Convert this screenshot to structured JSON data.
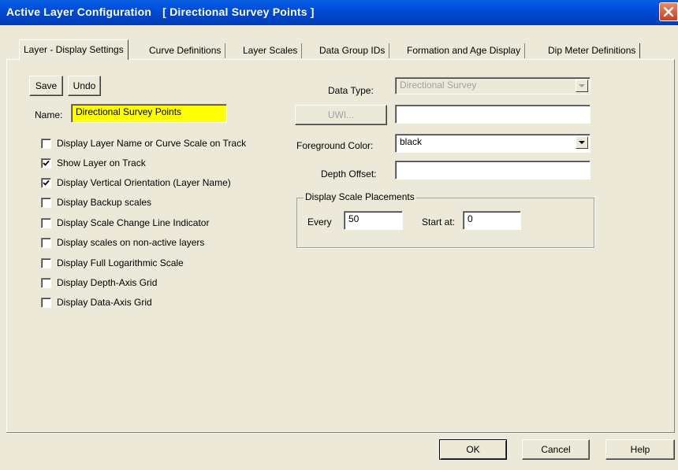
{
  "window": {
    "title_prefix": "Active Layer Configuration",
    "title_suffix": "[ Directional Survey Points ]"
  },
  "tabs": [
    {
      "label": "Layer - Display Settings",
      "active": true
    },
    {
      "label": "Curve Definitions",
      "active": false
    },
    {
      "label": "Layer Scales",
      "active": false
    },
    {
      "label": "Data Group IDs",
      "active": false
    },
    {
      "label": "Formation and Age Display",
      "active": false
    },
    {
      "label": "Dip Meter Definitions",
      "active": false
    }
  ],
  "left": {
    "save_label": "Save",
    "undo_label": "Undo",
    "name_label": "Name:",
    "name_value": "Directional Survey Points",
    "checkboxes": [
      {
        "label": "Display Layer Name or Curve Scale on Track",
        "checked": false
      },
      {
        "label": "Show Layer on Track",
        "checked": true
      },
      {
        "label": "Display Vertical Orientation (Layer Name)",
        "checked": true
      },
      {
        "label": "Display Backup scales",
        "checked": false
      },
      {
        "label": "Display Scale Change Line Indicator",
        "checked": false
      },
      {
        "label": "Display scales on non-active layers",
        "checked": false
      },
      {
        "label": "Display Full Logarithmic Scale",
        "checked": false
      },
      {
        "label": "Display Depth-Axis Grid",
        "checked": false
      },
      {
        "label": "Display Data-Axis Grid",
        "checked": false
      }
    ]
  },
  "right": {
    "data_type_label": "Data Type:",
    "data_type_value": "Directional Survey",
    "uwi_button": "UWI...",
    "uwi_value": "",
    "foreground_label": "Foreground Color:",
    "foreground_value": "black",
    "depth_offset_label": "Depth Offset:",
    "depth_offset_value": "",
    "scale_group_label": "Display Scale Placements",
    "every_label": "Every",
    "every_value": "50",
    "start_at_label": "Start at:",
    "start_at_value": "0"
  },
  "footer": {
    "ok_label": "OK",
    "cancel_label": "Cancel",
    "help_label": "Help"
  },
  "colors": {
    "titlebar": "#0054e3",
    "dialog_bg": "#ece9d8",
    "name_highlight": "#ffff00",
    "close_button": "#c8401e"
  }
}
